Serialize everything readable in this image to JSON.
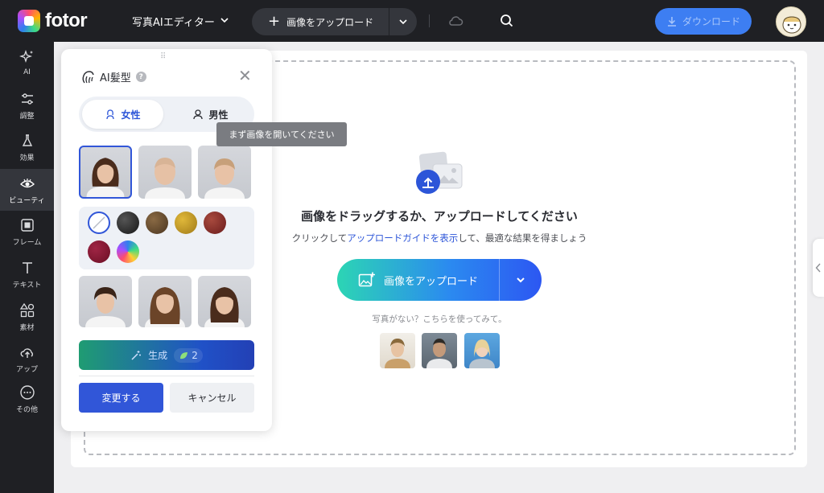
{
  "header": {
    "logo_text": "fotor",
    "editor_title": "写真AIエディター",
    "upload_label": "画像をアップロード",
    "download_label": "ダウンロード"
  },
  "sidebar": {
    "items": [
      {
        "label": "AI",
        "icon": "sparkle-icon"
      },
      {
        "label": "調整",
        "icon": "sliders-icon"
      },
      {
        "label": "効果",
        "icon": "flask-icon"
      },
      {
        "label": "ビューティ",
        "icon": "eye-icon"
      },
      {
        "label": "フレーム",
        "icon": "frame-icon"
      },
      {
        "label": "テキスト",
        "icon": "text-icon"
      },
      {
        "label": "素材",
        "icon": "shapes-icon"
      },
      {
        "label": "アップ",
        "icon": "cloud-upload-icon"
      },
      {
        "label": "その他",
        "icon": "more-icon"
      }
    ],
    "active_index": 3
  },
  "panel": {
    "title": "AI髪型",
    "help": "?",
    "tabs": {
      "female": "女性",
      "male": "男性"
    },
    "tooltip": "まず画像を開いてください",
    "generate_label": "生成",
    "credit": "2",
    "apply_label": "変更する",
    "cancel_label": "キャンセル",
    "swatch_colors": [
      "#161616",
      "#4a3520",
      "#a07a18",
      "#6b1c1c",
      "#6a0f24"
    ]
  },
  "main": {
    "headline": "画像をドラッグするか、アップロードしてください",
    "sub_prefix": "クリックして",
    "sub_link": "アップロードガイドを表示",
    "sub_suffix": "して、最適な結果を得ましょう",
    "upload_label": "画像をアップロード",
    "samples_label": "写真がない？こちらを使ってみて。"
  },
  "colors": {
    "accent": "#3156d8",
    "topbar": "#1f2024",
    "download": "#3d7ef2"
  }
}
